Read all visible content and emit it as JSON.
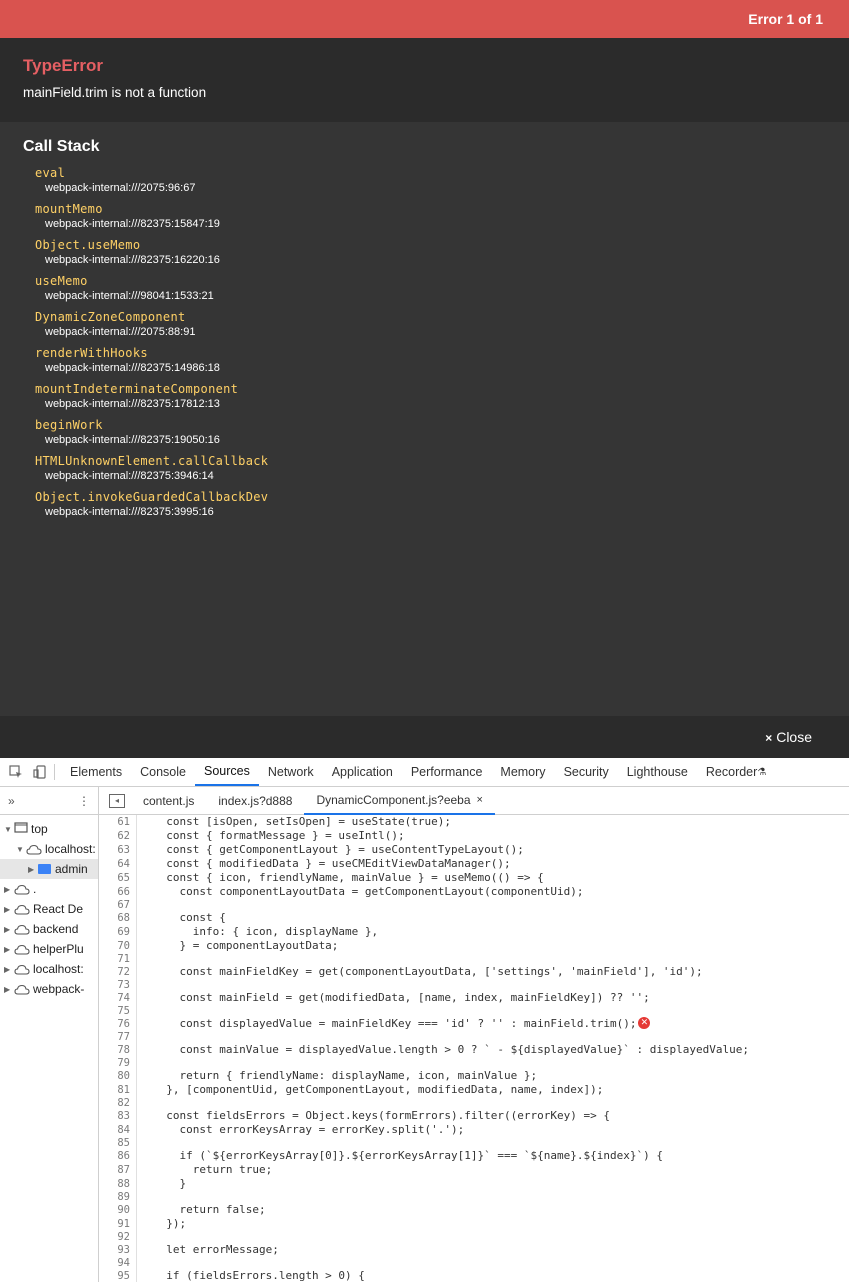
{
  "overlay": {
    "error_count": "Error 1 of 1",
    "error_type": "TypeError",
    "error_message": "mainField.trim is not a function",
    "callstack_title": "Call Stack",
    "frames": [
      {
        "fn": "eval",
        "loc": "webpack-internal:///2075:96:67"
      },
      {
        "fn": "mountMemo",
        "loc": "webpack-internal:///82375:15847:19"
      },
      {
        "fn": "Object.useMemo",
        "loc": "webpack-internal:///82375:16220:16"
      },
      {
        "fn": "useMemo",
        "loc": "webpack-internal:///98041:1533:21"
      },
      {
        "fn": "DynamicZoneComponent",
        "loc": "webpack-internal:///2075:88:91"
      },
      {
        "fn": "renderWithHooks",
        "loc": "webpack-internal:///82375:14986:18"
      },
      {
        "fn": "mountIndeterminateComponent",
        "loc": "webpack-internal:///82375:17812:13"
      },
      {
        "fn": "beginWork",
        "loc": "webpack-internal:///82375:19050:16"
      },
      {
        "fn": "HTMLUnknownElement.callCallback",
        "loc": "webpack-internal:///82375:3946:14"
      },
      {
        "fn": "Object.invokeGuardedCallbackDev",
        "loc": "webpack-internal:///82375:3995:16"
      }
    ],
    "close_label": "Close"
  },
  "devtools": {
    "tabs": [
      "Elements",
      "Console",
      "Sources",
      "Network",
      "Application",
      "Performance",
      "Memory",
      "Security",
      "Lighthouse",
      "Recorder"
    ],
    "active_tab": "Sources",
    "nav_more": "»",
    "nav_menu": "⋮",
    "file_tabs": [
      "content.js",
      "index.js?d888",
      "DynamicComponent.js?eeba"
    ],
    "active_file": "DynamicComponent.js?eeba",
    "tree": [
      {
        "label": "top",
        "indent": 0,
        "expanded": true,
        "type": "frame"
      },
      {
        "label": "localhost:",
        "indent": 1,
        "expanded": true,
        "type": "cloud"
      },
      {
        "label": "admin",
        "indent": 2,
        "expanded": false,
        "type": "folder"
      },
      {
        "label": ".",
        "indent": 0,
        "expanded": false,
        "type": "cloud"
      },
      {
        "label": "React De",
        "indent": 0,
        "expanded": false,
        "type": "cloud"
      },
      {
        "label": "backend",
        "indent": 0,
        "expanded": false,
        "type": "cloud"
      },
      {
        "label": "helperPlu",
        "indent": 0,
        "expanded": false,
        "type": "cloud"
      },
      {
        "label": "localhost:",
        "indent": 0,
        "expanded": false,
        "type": "cloud"
      },
      {
        "label": "webpack-",
        "indent": 0,
        "expanded": false,
        "type": "cloud"
      }
    ],
    "code": [
      {
        "n": "61",
        "t": "  const [isOpen, setIsOpen] = useState(true);"
      },
      {
        "n": "62",
        "t": "  const { formatMessage } = useIntl();"
      },
      {
        "n": "63",
        "t": "  const { getComponentLayout } = useContentTypeLayout();"
      },
      {
        "n": "64",
        "t": "  const { modifiedData } = useCMEditViewDataManager();"
      },
      {
        "n": "65",
        "t": "  const { icon, friendlyName, mainValue } = useMemo(() => {"
      },
      {
        "n": "66",
        "t": "    const componentLayoutData = getComponentLayout(componentUid);"
      },
      {
        "n": "67",
        "t": ""
      },
      {
        "n": "68",
        "t": "    const {"
      },
      {
        "n": "69",
        "t": "      info: { icon, displayName },"
      },
      {
        "n": "70",
        "t": "    } = componentLayoutData;"
      },
      {
        "n": "71",
        "t": ""
      },
      {
        "n": "72",
        "t": "    const mainFieldKey = get(componentLayoutData, ['settings', 'mainField'], 'id');"
      },
      {
        "n": "73",
        "t": ""
      },
      {
        "n": "74",
        "t": "    const mainField = get(modifiedData, [name, index, mainFieldKey]) ?? '';"
      },
      {
        "n": "75",
        "t": ""
      },
      {
        "n": "76",
        "t": "    const displayedValue = mainFieldKey === 'id' ? '' : mainField.trim();",
        "error": true
      },
      {
        "n": "77",
        "t": ""
      },
      {
        "n": "78",
        "t": "    const mainValue = displayedValue.length > 0 ? ` - ${displayedValue}` : displayedValue;"
      },
      {
        "n": "79",
        "t": ""
      },
      {
        "n": "80",
        "t": "    return { friendlyName: displayName, icon, mainValue };"
      },
      {
        "n": "81",
        "t": "  }, [componentUid, getComponentLayout, modifiedData, name, index]);"
      },
      {
        "n": "82",
        "t": ""
      },
      {
        "n": "83",
        "t": "  const fieldsErrors = Object.keys(formErrors).filter((errorKey) => {"
      },
      {
        "n": "84",
        "t": "    const errorKeysArray = errorKey.split('.');"
      },
      {
        "n": "85",
        "t": ""
      },
      {
        "n": "86",
        "t": "    if (`${errorKeysArray[0]}.${errorKeysArray[1]}` === `${name}.${index}`) {"
      },
      {
        "n": "87",
        "t": "      return true;"
      },
      {
        "n": "88",
        "t": "    }"
      },
      {
        "n": "89",
        "t": ""
      },
      {
        "n": "90",
        "t": "    return false;"
      },
      {
        "n": "91",
        "t": "  });"
      },
      {
        "n": "92",
        "t": ""
      },
      {
        "n": "93",
        "t": "  let errorMessage;"
      },
      {
        "n": "94",
        "t": ""
      },
      {
        "n": "95",
        "t": "  if (fieldsErrors.length > 0) {"
      }
    ]
  }
}
